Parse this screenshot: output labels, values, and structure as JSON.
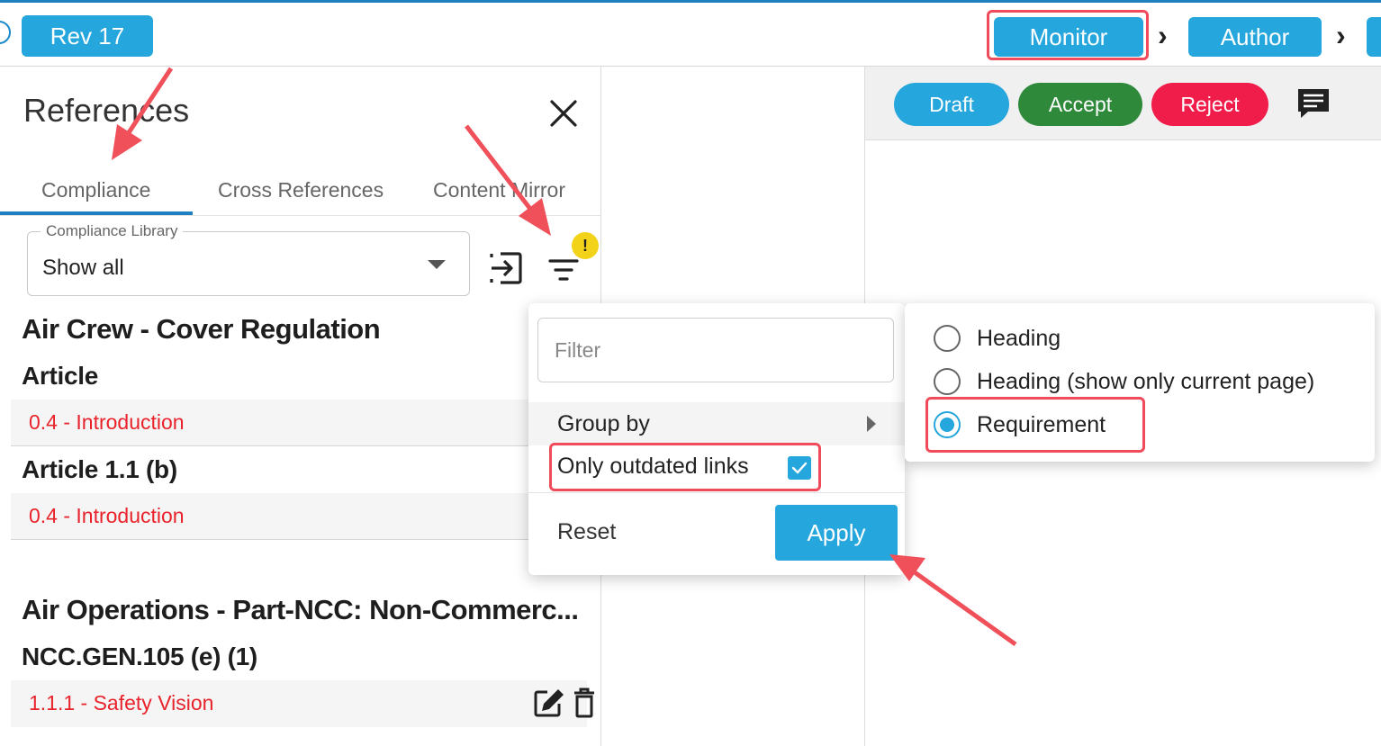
{
  "header": {
    "rev_label": "Rev 17",
    "stages": [
      "Monitor",
      "Author"
    ],
    "chevron": "›"
  },
  "references": {
    "title": "References",
    "tabs": [
      "Compliance",
      "Cross References",
      "Content Mirror"
    ],
    "active_tab": "Compliance",
    "library_select": {
      "legend": "Compliance Library",
      "value": "Show all"
    },
    "filter_badge": "!",
    "groups": [
      {
        "title": "Air Crew - Cover Regulation",
        "articles": [
          {
            "title": "Article",
            "link": "0.4 - Introduction"
          },
          {
            "title": "Article 1.1 (b)",
            "link": "0.4 - Introduction"
          }
        ]
      },
      {
        "title": "Air Operations - Part-NCC: Non-Commerc...",
        "articles": [
          {
            "title": "NCC.GEN.105 (e) (1)",
            "link": "1.1.1 - Safety Vision"
          }
        ]
      }
    ]
  },
  "review_actions": {
    "draft": "Draft",
    "accept": "Accept",
    "reject": "Reject"
  },
  "filter_popover": {
    "placeholder": "Filter",
    "group_by_label": "Group by",
    "outdated_label": "Only outdated links",
    "outdated_checked": true,
    "reset_label": "Reset",
    "apply_label": "Apply"
  },
  "group_by_options": [
    {
      "label": "Heading",
      "selected": false
    },
    {
      "label": "Heading (show only current page)",
      "selected": false
    },
    {
      "label": "Requirement",
      "selected": true
    }
  ],
  "colors": {
    "accent": "#25a6dc",
    "accept": "#2e8a3a",
    "reject": "#f01c4a",
    "link": "#e8232b",
    "highlight": "#ef4b5a",
    "badge": "#f3d21a"
  },
  "icons": [
    "close-icon",
    "export-icon",
    "filter-icon",
    "comment-icon",
    "edit-icon",
    "trash-icon",
    "check-icon"
  ]
}
